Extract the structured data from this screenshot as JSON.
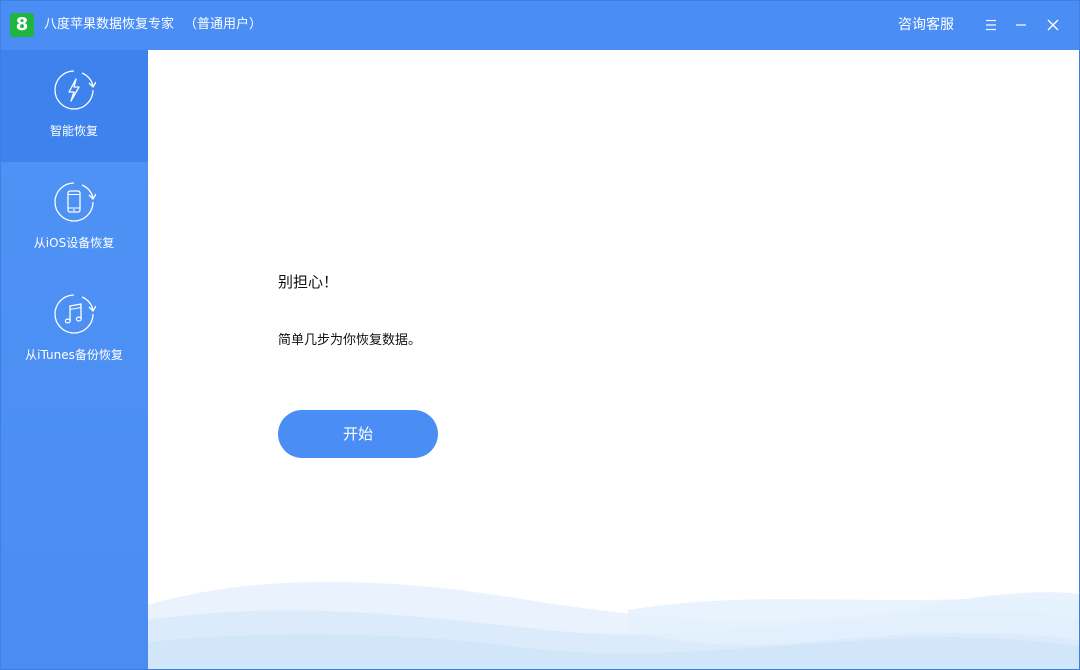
{
  "titlebar": {
    "logo_glyph": "8",
    "app_name": "八度苹果数据恢复专家",
    "user_type": "（普通用户）",
    "support_label": "咨询客服",
    "menu_icon": "menu-icon",
    "minimize_icon": "minimize-icon",
    "close_icon": "close-icon"
  },
  "sidebar": {
    "items": [
      {
        "label": "智能恢复",
        "icon": "smart-recovery-icon",
        "active": true
      },
      {
        "label": "从iOS设备恢复",
        "icon": "phone-recovery-icon",
        "active": false
      },
      {
        "label": "从iTunes备份恢复",
        "icon": "music-recovery-icon",
        "active": false
      }
    ]
  },
  "main": {
    "headline": "别担心！",
    "subline": "简单几步为你恢复数据。",
    "start_label": "开始"
  },
  "colors": {
    "primary": "#4a8ef5",
    "sidebar_active": "#3e82ee",
    "logo_green": "#1fb53f"
  }
}
